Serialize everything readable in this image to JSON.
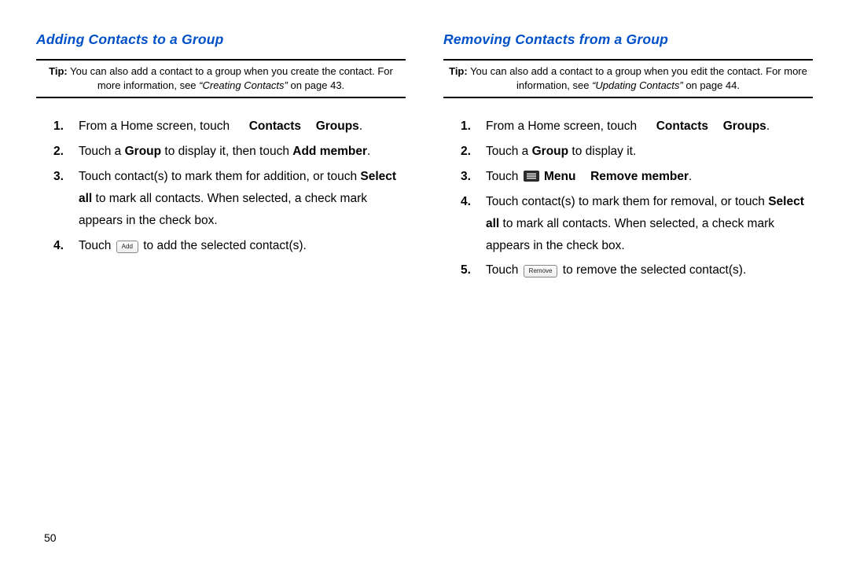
{
  "pageNumber": "50",
  "left": {
    "title": "Adding Contacts to a Group",
    "tip": {
      "label": "Tip:",
      "text_before": " You can also add a contact to a group when you create the contact. For more information, see ",
      "xref": "“Creating Contacts”",
      "text_after": " on page 43."
    },
    "step1": {
      "pre": "From a Home screen, touch ",
      "contacts": "Contacts",
      "groups": "Groups",
      "post": "."
    },
    "step2": {
      "t1": "Touch a ",
      "b1": "Group",
      "t2": " to display it, then touch ",
      "b2": "Add member",
      "t3": "."
    },
    "step3": {
      "t1": "Touch contact(s) to mark them for addition, or touch ",
      "b1": "Select all",
      "t2": " to mark all contacts. When selected, a check mark appears in the check box."
    },
    "step4": {
      "t1": "Touch ",
      "btn": "Add",
      "t2": " to add the selected contact(s)."
    }
  },
  "right": {
    "title": "Removing Contacts from a Group",
    "tip": {
      "label": "Tip:",
      "text_before": " You can also add a contact to a group when you edit the contact. For more information, see ",
      "xref": "“Updating Contacts”",
      "text_after": " on page 44."
    },
    "step1": {
      "pre": "From a Home screen, touch ",
      "contacts": "Contacts",
      "groups": "Groups",
      "post": "."
    },
    "step2": {
      "t1": "Touch a ",
      "b1": "Group",
      "t2": " to display it."
    },
    "step3": {
      "t1": "Touch ",
      "b1": "Menu",
      "b2": "Remove member",
      "t2": "."
    },
    "step4": {
      "t1": "Touch contact(s) to mark them for removal, or touch ",
      "b1": "Select all",
      "t2": " to mark all contacts. When selected, a check mark appears in the check box."
    },
    "step5": {
      "t1": "Touch ",
      "btn": "Remove",
      "t2": " to remove the selected contact(s)."
    }
  }
}
